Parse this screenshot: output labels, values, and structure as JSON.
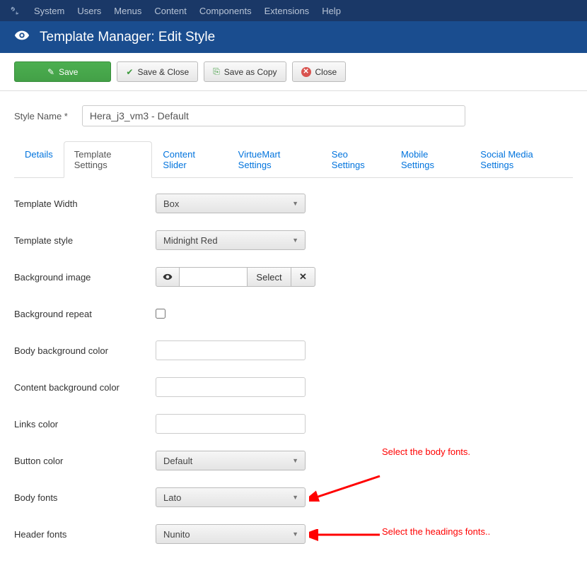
{
  "topbar": {
    "menus": [
      "System",
      "Users",
      "Menus",
      "Content",
      "Components",
      "Extensions",
      "Help"
    ]
  },
  "header": {
    "title": "Template Manager: Edit Style"
  },
  "toolbar": {
    "save": "Save",
    "save_close": "Save & Close",
    "save_copy": "Save as Copy",
    "close": "Close"
  },
  "style_name": {
    "label": "Style Name *",
    "value": "Hera_j3_vm3 - Default"
  },
  "tabs": [
    {
      "label": "Details",
      "active": false
    },
    {
      "label": "Template Settings",
      "active": true
    },
    {
      "label": "Content Slider",
      "active": false
    },
    {
      "label": "VirtueMart Settings",
      "active": false
    },
    {
      "label": "Seo Settings",
      "active": false
    },
    {
      "label": "Mobile Settings",
      "active": false
    },
    {
      "label": "Social Media Settings",
      "active": false
    }
  ],
  "fields": {
    "template_width": {
      "label": "Template Width",
      "value": "Box"
    },
    "template_style": {
      "label": "Template style",
      "value": "Midnight Red"
    },
    "bg_image": {
      "label": "Background image",
      "select_btn": "Select"
    },
    "bg_repeat": {
      "label": "Background repeat"
    },
    "body_bg": {
      "label": "Body background color",
      "value": ""
    },
    "content_bg": {
      "label": "Content background color",
      "value": ""
    },
    "links_color": {
      "label": "Links color",
      "value": ""
    },
    "button_color": {
      "label": "Button color",
      "value": "Default"
    },
    "body_fonts": {
      "label": "Body fonts",
      "value": "Lato"
    },
    "header_fonts": {
      "label": "Header fonts",
      "value": "Nunito"
    }
  },
  "annotations": {
    "body_fonts": "Select the body fonts.",
    "header_fonts": "Select the headings fonts.."
  }
}
